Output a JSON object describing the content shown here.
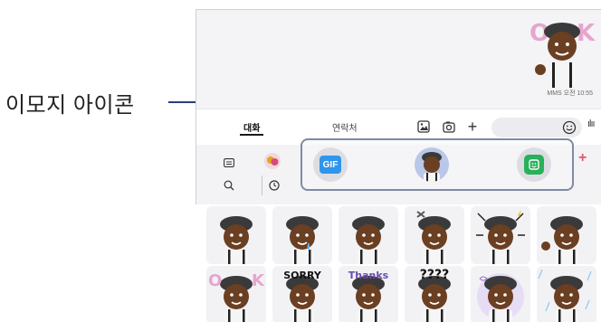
{
  "callout": {
    "label": "이모지 아이콘"
  },
  "chat": {
    "timestamp": "MMS 오전 10:55"
  },
  "tabs": [
    {
      "label": "대화"
    },
    {
      "label": "연락처"
    }
  ],
  "toolbar_icons": [
    "gallery-icon",
    "camera-icon",
    "plus-icon",
    "emoji-icon",
    "voice-icon"
  ],
  "side_icons": [
    "keyboard-icon",
    "emoji-face-icon",
    "search-icon",
    "recent-icon"
  ],
  "pickers": [
    {
      "name": "gif-picker",
      "label": "GIF",
      "color": "#2f95ea"
    },
    {
      "name": "ar-emoji-picker",
      "label": ""
    },
    {
      "name": "sticker-picker",
      "label": "",
      "color": "#28b05a"
    }
  ],
  "stickers": [
    {
      "kind": "plain",
      "caption": ""
    },
    {
      "kind": "tear",
      "caption": ""
    },
    {
      "kind": "plain",
      "caption": ""
    },
    {
      "kind": "angry",
      "caption": ""
    },
    {
      "kind": "shock",
      "caption": ""
    },
    {
      "kind": "wave",
      "caption": ""
    },
    {
      "kind": "ok",
      "caption": ""
    },
    {
      "kind": "sorry",
      "caption": "SORRY"
    },
    {
      "kind": "thanks",
      "caption": "Thanks"
    },
    {
      "kind": "confused",
      "caption": "????"
    },
    {
      "kind": "dizzy",
      "caption": ""
    },
    {
      "kind": "rain",
      "caption": ""
    }
  ],
  "colors": {
    "callout_line": "#2a3d82",
    "accent_plus": "#e05a6e",
    "skin": "#6b3f22",
    "hat": "#3a3a3a"
  }
}
